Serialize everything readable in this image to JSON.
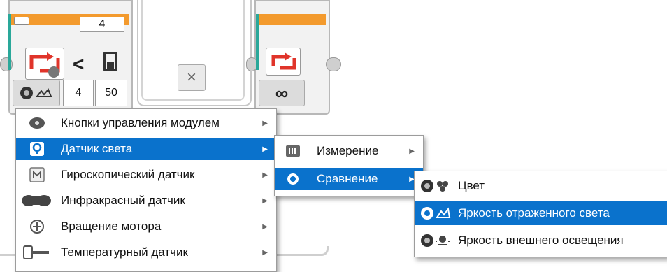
{
  "canvas": {
    "top_block_value": "4",
    "operator": "<",
    "param_a": "4",
    "param_b": "50",
    "infinity": "∞",
    "close_symbol": "×"
  },
  "main_menu": {
    "items": [
      {
        "label": "Кнопки управления модулем",
        "icon": "brick-buttons-icon"
      },
      {
        "label": "Датчик света",
        "icon": "light-sensor-icon"
      },
      {
        "label": "Гироскопический датчик",
        "icon": "gyro-sensor-icon"
      },
      {
        "label": "Инфракрасный датчик",
        "icon": "infrared-sensor-icon"
      },
      {
        "label": "Вращение мотора",
        "icon": "motor-rotation-icon"
      },
      {
        "label": "Температурный датчик",
        "icon": "temperature-sensor-icon"
      }
    ],
    "selected_index": 1
  },
  "sub_menu": {
    "items": [
      {
        "label": "Измерение",
        "icon": "measure-icon"
      },
      {
        "label": "Сравнение",
        "icon": "compare-icon"
      }
    ],
    "selected_index": 1
  },
  "third_menu": {
    "items": [
      {
        "label": "Цвет",
        "icon": "color-mode-icon"
      },
      {
        "label": "Яркость отраженного света",
        "icon": "reflected-light-icon"
      },
      {
        "label": "Яркость внешнего освещения",
        "icon": "ambient-light-icon"
      }
    ],
    "selected_index": 1
  },
  "colors": {
    "accent": "#0a72cc",
    "block_orange": "#f39a2d",
    "connector_teal": "#2aa89a",
    "icon_red": "#e0342a"
  }
}
